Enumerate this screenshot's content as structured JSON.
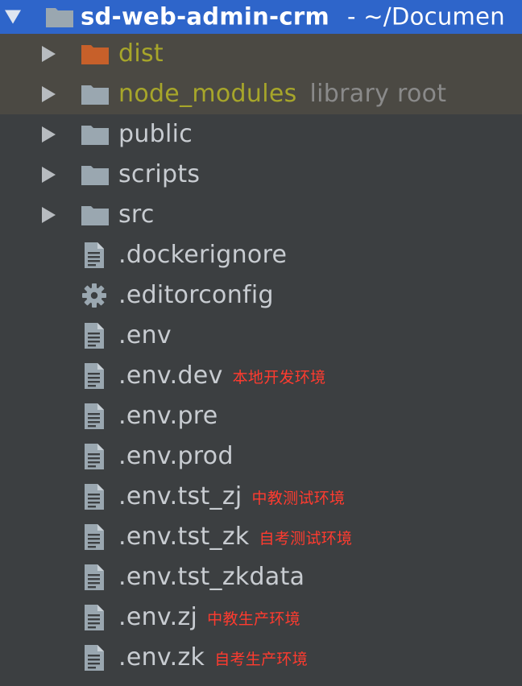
{
  "root": {
    "name": "sd-web-admin-crm",
    "path": "- ~/Documen"
  },
  "items": [
    {
      "name": "dist",
      "kind": "folder",
      "icon": "folder-orange-icon",
      "excluded": true
    },
    {
      "name": "node_modules",
      "kind": "folder",
      "icon": "folder-icon",
      "excluded": true,
      "hint": "library root"
    },
    {
      "name": "public",
      "kind": "folder",
      "icon": "folder-icon"
    },
    {
      "name": "scripts",
      "kind": "folder",
      "icon": "folder-icon"
    },
    {
      "name": "src",
      "kind": "folder",
      "icon": "folder-icon"
    },
    {
      "name": ".dockerignore",
      "kind": "file",
      "icon": "text-file-icon"
    },
    {
      "name": ".editorconfig",
      "kind": "file",
      "icon": "gear-icon"
    },
    {
      "name": ".env",
      "kind": "file",
      "icon": "text-file-icon"
    },
    {
      "name": ".env.dev",
      "kind": "file",
      "icon": "text-file-icon",
      "note": "本地开发环境"
    },
    {
      "name": ".env.pre",
      "kind": "file",
      "icon": "text-file-icon"
    },
    {
      "name": ".env.prod",
      "kind": "file",
      "icon": "text-file-icon"
    },
    {
      "name": ".env.tst_zj",
      "kind": "file",
      "icon": "text-file-icon",
      "note": "中教测试环境"
    },
    {
      "name": ".env.tst_zk",
      "kind": "file",
      "icon": "text-file-icon",
      "note": "自考测试环境"
    },
    {
      "name": ".env.tst_zkdata",
      "kind": "file",
      "icon": "text-file-icon"
    },
    {
      "name": ".env.zj",
      "kind": "file",
      "icon": "text-file-icon",
      "note": "中教生产环境"
    },
    {
      "name": ".env.zk",
      "kind": "file",
      "icon": "text-file-icon",
      "note": "自考生产环境"
    }
  ],
  "colors": {
    "background": "#3c3f41",
    "selection": "#2e65ca",
    "excluded_row": "#4b4943",
    "excluded_text": "#a7a62a",
    "note_text": "#ff3b2f"
  }
}
